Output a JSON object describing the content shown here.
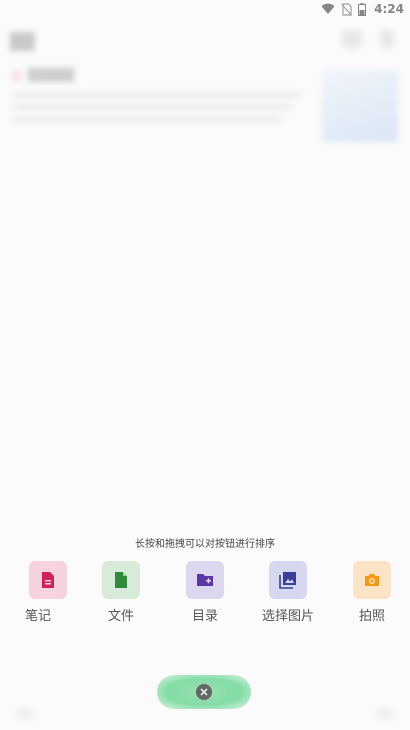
{
  "status_bar": {
    "time": "4:24",
    "icons": [
      "wifi-icon",
      "no-sim-icon",
      "battery-icon"
    ]
  },
  "background": {
    "title": "██",
    "card_title": "█████"
  },
  "hint": "长按和拖拽可以对按钮进行排序",
  "actions": [
    {
      "id": "note",
      "label": "笔记",
      "icon": "note-icon",
      "tile_color": "#f6d3dd",
      "icon_color": "#d0215a"
    },
    {
      "id": "file",
      "label": "文件",
      "icon": "file-icon",
      "tile_color": "#d8ead9",
      "icon_color": "#2e8b3a"
    },
    {
      "id": "folder",
      "label": "目录",
      "icon": "folder-add-icon",
      "tile_color": "#dcd6ee",
      "icon_color": "#5b35a8"
    },
    {
      "id": "image",
      "label": "选择图片",
      "icon": "image-icon",
      "tile_color": "#d6d8ef",
      "icon_color": "#3a3f9a"
    },
    {
      "id": "camera",
      "label": "拍照",
      "icon": "camera-icon",
      "tile_color": "#fbe3c5",
      "icon_color": "#f39a10"
    }
  ],
  "fab": {
    "icon": "close-icon",
    "color": "#5fd48e"
  }
}
